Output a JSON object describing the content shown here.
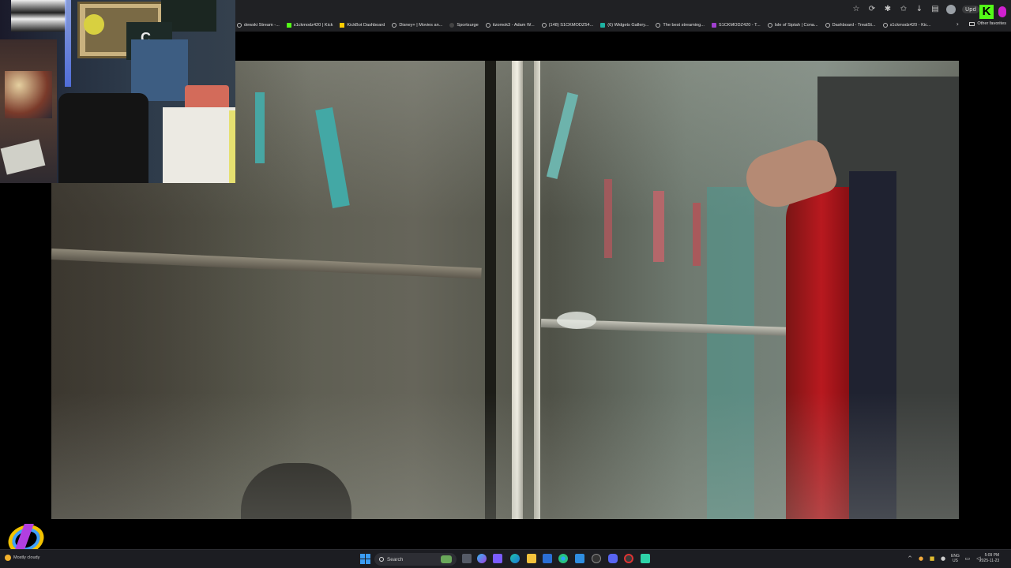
{
  "browser": {
    "bookmarks": [
      {
        "label": "dewski Stream -...",
        "icon": "globe-icon"
      },
      {
        "label": "s1ckmodz420 | Kick",
        "icon": "kick-icon"
      },
      {
        "label": "KickBot Dashboard",
        "icon": "star-icon"
      },
      {
        "label": "Disney+ | Movies an...",
        "icon": "globe-icon"
      },
      {
        "label": "Sportsurge",
        "icon": "dark-icon"
      },
      {
        "label": "itzomok3 - Adam W...",
        "icon": "globe-icon"
      },
      {
        "label": "(148) S1CKMODZ54...",
        "icon": "globe-icon"
      },
      {
        "label": "(6) Widgets Gallery...",
        "icon": "teal-icon"
      },
      {
        "label": "The best streaming...",
        "icon": "globe-icon"
      },
      {
        "label": "S1CKMODZ420 - T...",
        "icon": "purple-icon"
      },
      {
        "label": "Isle of Siptah | Cona...",
        "icon": "globe-icon"
      },
      {
        "label": "Dashboard - TreatSt...",
        "icon": "globe-icon"
      },
      {
        "label": "s1ckmodz420 - Kic...",
        "icon": "globe-icon"
      }
    ],
    "other_favorites_label": "Other favorites",
    "update_label": "Upd",
    "kick_letter": "K"
  },
  "webcam": {
    "jersey_text": "C"
  },
  "taskbar": {
    "weather_text": "Mostly cloudy",
    "search_label": "Search",
    "language_top": "ENG",
    "language_bottom": "US",
    "time": "5:09 PM",
    "date": "2025-11-23"
  },
  "colors": {
    "kick_green": "#53fc18",
    "windows_blue": "#3b9cf2"
  }
}
